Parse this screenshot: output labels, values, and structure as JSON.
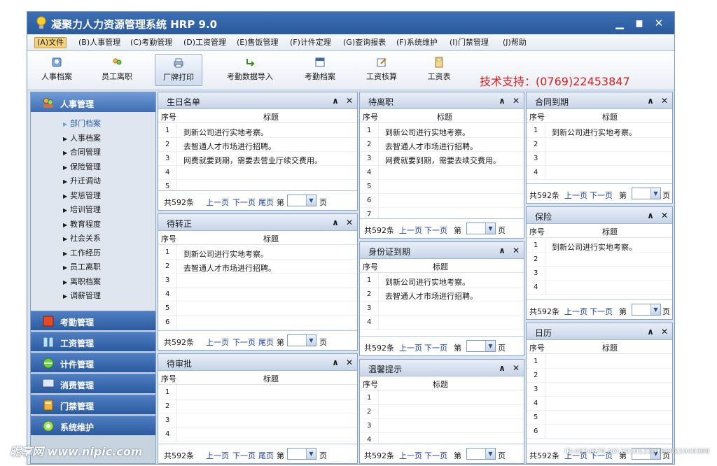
{
  "window": {
    "title": "凝聚力人力资源管理系统 HRP 9.0",
    "minimize": "▁",
    "maximize": "▆",
    "close": "✕"
  },
  "menu": [
    "(A)文件",
    "(B)人事管理",
    "(C)考勤管理",
    "(D)工资管理",
    "(E)售饭管理",
    "(F)计件定理",
    "(G)查询报表",
    "(F)系统维护",
    "(I)门禁管理",
    "(J)帮助"
  ],
  "toolbar": [
    "人事档案",
    "员工离职",
    "厂牌打印",
    "考勤数据导入",
    "考勤档案",
    "工资核算",
    "工资表"
  ],
  "support": "技术支持：(0769)22453847",
  "sidebar": {
    "sections": [
      "人事管理",
      "考勤管理",
      "工资管理",
      "计件管理",
      "消费管理",
      "门禁管理",
      "系统维护"
    ],
    "tree": [
      "部门档案",
      "人事档案",
      "合同管理",
      "保险管理",
      "升迁调动",
      "奖惩管理",
      "培训管理",
      "教育程度",
      "社会关系",
      "工作经历",
      "员工离职",
      "离职档案",
      "调薪管理"
    ]
  },
  "common": {
    "col_no": "序号",
    "col_title": "标题",
    "total": "共592条",
    "prev": "上一页",
    "next": "下一页",
    "last": "尾页",
    "page_prefix": "第",
    "page_suffix": "页",
    "dropdown": "▼"
  },
  "panels": {
    "birthday": {
      "title": "生日名单",
      "rows": [
        {
          "no": "1",
          "text": "到新公司进行实地考察。"
        },
        {
          "no": "2",
          "text": "去智通人才市场进行招聘。"
        },
        {
          "no": "3",
          "text": "网费就要到期，需要去营业厅续交费用。"
        },
        {
          "no": "4",
          "text": ""
        },
        {
          "no": "5",
          "text": ""
        }
      ]
    },
    "confirm": {
      "title": "待转正",
      "rows": [
        {
          "no": "1",
          "text": "到新公司进行实地考察。"
        },
        {
          "no": "2",
          "text": "去智通人才市场进行招聘。"
        },
        {
          "no": "3",
          "text": ""
        },
        {
          "no": "4",
          "text": ""
        },
        {
          "no": "5",
          "text": ""
        },
        {
          "no": "6",
          "text": ""
        }
      ]
    },
    "approve": {
      "title": "待审批",
      "rows": [
        {
          "no": "1",
          "text": ""
        },
        {
          "no": "2",
          "text": ""
        },
        {
          "no": "3",
          "text": ""
        },
        {
          "no": "4",
          "text": ""
        }
      ]
    },
    "leave": {
      "title": "待离职",
      "rows": [
        {
          "no": "1",
          "text": "到新公司进行实地考察。"
        },
        {
          "no": "2",
          "text": "去智通人才市场进行招聘。"
        },
        {
          "no": "3",
          "text": "网费就要到期，需要去续交费用。"
        },
        {
          "no": "4",
          "text": ""
        },
        {
          "no": "5",
          "text": ""
        },
        {
          "no": "6",
          "text": ""
        },
        {
          "no": "7",
          "text": ""
        }
      ]
    },
    "idcard": {
      "title": "身份证到期",
      "rows": [
        {
          "no": "1",
          "text": "到新公司进行实地考察。"
        },
        {
          "no": "2",
          "text": "去智通人才市场进行招聘。"
        },
        {
          "no": "3",
          "text": ""
        },
        {
          "no": "4",
          "text": ""
        }
      ]
    },
    "tips": {
      "title": "温馨提示",
      "rows": [
        {
          "no": "1",
          "text": ""
        },
        {
          "no": "2",
          "text": ""
        },
        {
          "no": "3",
          "text": ""
        },
        {
          "no": "4",
          "text": ""
        }
      ]
    },
    "contract": {
      "title": "合同到期",
      "rows": [
        {
          "no": "1",
          "text": "到新公司进行实地考察。"
        },
        {
          "no": "2",
          "text": ""
        },
        {
          "no": "3",
          "text": ""
        },
        {
          "no": "4",
          "text": ""
        }
      ]
    },
    "insurance": {
      "title": "保险",
      "rows": [
        {
          "no": "1",
          "text": "到新公司进行实地考察。"
        },
        {
          "no": "2",
          "text": ""
        },
        {
          "no": "3",
          "text": ""
        },
        {
          "no": "4",
          "text": ""
        }
      ]
    },
    "calendar": {
      "title": "日历",
      "rows": [
        {
          "no": "1",
          "text": ""
        },
        {
          "no": "2",
          "text": ""
        },
        {
          "no": "3",
          "text": ""
        },
        {
          "no": "4",
          "text": ""
        },
        {
          "no": "5",
          "text": ""
        },
        {
          "no": "6",
          "text": ""
        }
      ]
    }
  },
  "watermark": {
    "text": "昵享网 www.nipic.com",
    "id": "ID:4834670 NO:20101220180921049399"
  },
  "colors": {
    "title_bar": "#2f62a6",
    "accent": "#3e6db1",
    "support_text": "#e11b1b",
    "link": "#1a3fa0"
  }
}
